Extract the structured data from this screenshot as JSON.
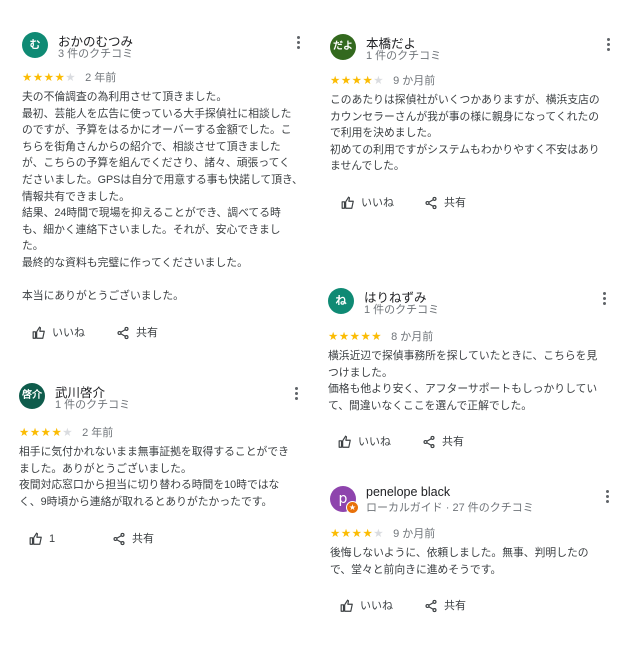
{
  "review_labels": {
    "like": "いいね",
    "share": "共有"
  },
  "colors": {
    "star": "#fbbc04",
    "star_empty": "#dadce0"
  },
  "reviews": [
    {
      "avatar_text": "む",
      "avatar_color": "#0f8a74",
      "name": "おかのむつみ",
      "meta": "3 件のクチコミ",
      "rating": 4,
      "age": "2 年前",
      "lines": [
        "夫の不倫調査の為利用させて頂きました。",
        "最初、芸能人を広告に使っている大手探偵社に相談した",
        "のですが、予算をはるかにオーバーする金額でした。こ",
        "ちらを街角さんからの紹介で、相談させて頂きました",
        "が、こちらの予算を組んでくださり、諸々、頑張ってく",
        "ださいました。GPSは自分で用意する事も快諾して頂き、",
        "情報共有できました。",
        "結果、24時間で現場を抑えることができ、調べてる時",
        "も、細かく連絡下さいました。それが、安心できまし",
        "た。",
        "最終的な資料も完璧に作ってくださいました。",
        "",
        "本当にありがとうございました。"
      ],
      "like_label": "いいね"
    },
    {
      "avatar_text": "啓介",
      "avatar_color": "#0f5c4c",
      "name": "武川啓介",
      "meta": "1 件のクチコミ",
      "rating": 4,
      "age": "2 年前",
      "lines": [
        "相手に気付かれないまま無事証拠を取得することができ",
        "ました。ありがとうございました。",
        "夜間対応窓口から担当に切り替わる時間を10時ではな",
        "く、9時頃から連絡が取れるとありがたかったです。"
      ],
      "like_label": "1"
    },
    {
      "avatar_text": "だよ",
      "avatar_color": "#33691e",
      "name": "本橋だよ",
      "meta": "1 件のクチコミ",
      "rating": 4,
      "age": "9 か月前",
      "lines": [
        "このあたりは探偵社がいくつかありますが、横浜支店の",
        "カウンセラーさんが我が事の様に親身になってくれたの",
        "で利用を決めました。",
        "初めての利用ですがシステムもわかりやすく不安はあり",
        "ませんでした。"
      ],
      "like_label": "いいね"
    },
    {
      "avatar_text": "ね",
      "avatar_color": "#0f8a74",
      "name": "はりねずみ",
      "meta": "1 件のクチコミ",
      "rating": 5,
      "age": "8 か月前",
      "lines": [
        "横浜近辺で探偵事務所を探していたときに、こちらを見",
        "つけました。",
        "価格も他より安く、アフターサポートもしっかりしてい",
        "て、間違いなくここを選んで正解でした。"
      ],
      "like_label": "いいね"
    },
    {
      "avatar_text": "p",
      "avatar_color": "#8e44ad",
      "local_guide": true,
      "name": "penelope black",
      "meta": "ローカルガイド · 27 件のクチコミ",
      "rating": 4,
      "age": "9 か月前",
      "lines": [
        "後悔しないように、依頼しました。無事、判明したの",
        "で、堂々と前向きに進めそうです。"
      ],
      "like_label": "いいね"
    }
  ]
}
